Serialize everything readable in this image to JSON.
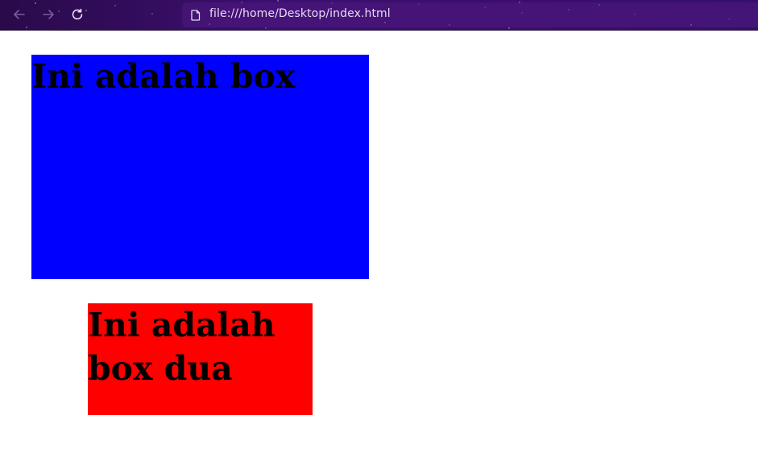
{
  "browser": {
    "url": "file:///home/Desktop/index.html",
    "icons": {
      "back": "arrow-left-icon",
      "forward": "arrow-right-icon",
      "reload": "reload-icon",
      "page": "page-icon"
    },
    "colors": {
      "toolbar": "#3b0f6e",
      "url_text": "#e6dcf2"
    }
  },
  "page": {
    "box_one": {
      "heading": "Ini adalah box",
      "color": "#0000ff"
    },
    "box_two": {
      "heading": "Ini adalah box dua",
      "color": "#ff0000"
    }
  }
}
